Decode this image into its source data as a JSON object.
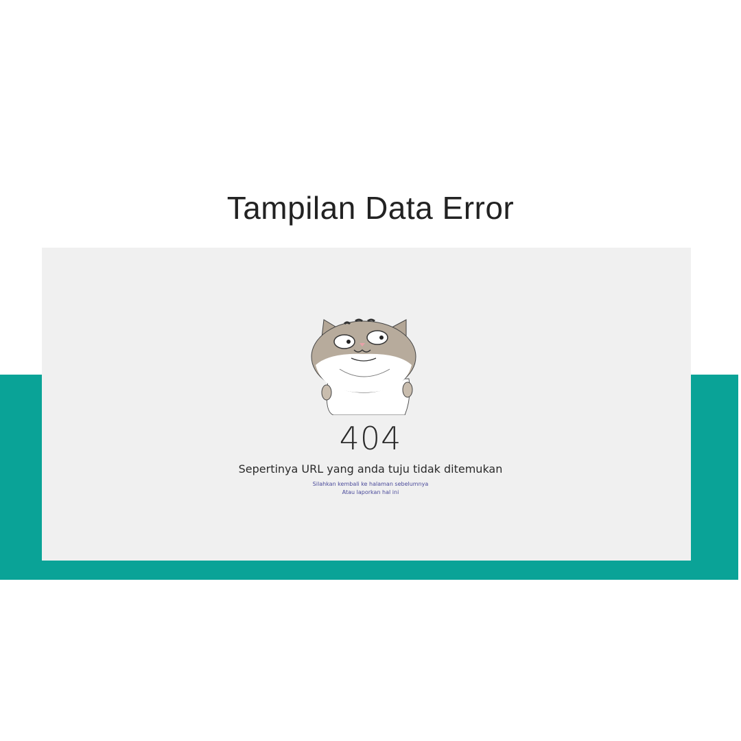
{
  "title": "Tampilan Data Error",
  "colors": {
    "accent": "#0aa397",
    "panel": "#f0f0f0",
    "background": "#ffffff"
  },
  "error": {
    "illustration": "cat-peeking-icon",
    "code": "404",
    "message": "Sepertinya URL yang anda tuju tidak ditemukan",
    "back_link": "Silahkan kembali ke halaman sebelumnya",
    "report_link": "Atau laporkan hal ini"
  }
}
